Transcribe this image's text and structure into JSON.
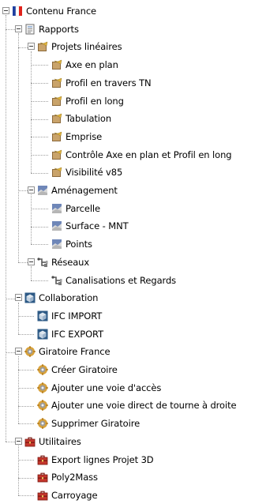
{
  "tree": {
    "root": {
      "label": "Contenu France",
      "icon": "france-flag-icon",
      "expanded": true
    },
    "groups": [
      {
        "label": "Rapports",
        "icon": "report-sheet-icon",
        "expanded": true,
        "children": [
          {
            "label": "Projets linéaires",
            "icon": "linear-project-icon",
            "expanded": true,
            "items": [
              {
                "label": "Axe en plan",
                "icon": "linear-project-icon"
              },
              {
                "label": "Profil en travers TN",
                "icon": "linear-project-icon"
              },
              {
                "label": "Profil en long",
                "icon": "linear-project-icon"
              },
              {
                "label": "Tabulation",
                "icon": "linear-project-icon"
              },
              {
                "label": "Emprise",
                "icon": "linear-project-icon"
              },
              {
                "label": "Contrôle Axe en plan et Profil en long",
                "icon": "linear-project-icon"
              },
              {
                "label": "Visibilité v85",
                "icon": "linear-project-icon"
              }
            ]
          },
          {
            "label": "Aménagement",
            "icon": "land-development-icon",
            "expanded": true,
            "items": [
              {
                "label": "Parcelle",
                "icon": "land-development-icon"
              },
              {
                "label": "Surface - MNT",
                "icon": "land-development-icon"
              },
              {
                "label": "Points",
                "icon": "land-development-icon"
              }
            ]
          },
          {
            "label": "Réseaux",
            "icon": "network-icon",
            "expanded": true,
            "items": [
              {
                "label": "Canalisations et Regards",
                "icon": "network-icon"
              }
            ]
          }
        ]
      },
      {
        "label": "Collaboration",
        "icon": "collaboration-cube-icon",
        "expanded": true,
        "items": [
          {
            "label": "IFC IMPORT",
            "icon": "collaboration-cube-icon"
          },
          {
            "label": "IFC EXPORT",
            "icon": "collaboration-cube-icon"
          }
        ]
      },
      {
        "label": "Giratoire France",
        "icon": "roundabout-gear-icon",
        "expanded": true,
        "items": [
          {
            "label": "Créer Giratoire",
            "icon": "roundabout-gear-icon"
          },
          {
            "label": "Ajouter une voie d'accès",
            "icon": "roundabout-gear-icon"
          },
          {
            "label": "Ajouter une voie direct de tourne à droite",
            "icon": "roundabout-gear-icon"
          },
          {
            "label": "Supprimer Giratoire",
            "icon": "roundabout-gear-icon"
          }
        ]
      },
      {
        "label": "Utilitaires",
        "icon": "toolbox-icon",
        "expanded": true,
        "items": [
          {
            "label": "Export lignes Projet 3D",
            "icon": "toolbox-icon"
          },
          {
            "label": "Poly2Mass",
            "icon": "toolbox-icon"
          },
          {
            "label": "Carroyage",
            "icon": "toolbox-icon"
          }
        ]
      }
    ]
  },
  "colors": {
    "background": "#ffffff",
    "text": "#000000",
    "connector": "#a0a0a0",
    "toggle_border": "#919191",
    "flag_blue": "#1e3fa0",
    "flag_white": "#ffffff",
    "flag_red": "#e0221b"
  }
}
